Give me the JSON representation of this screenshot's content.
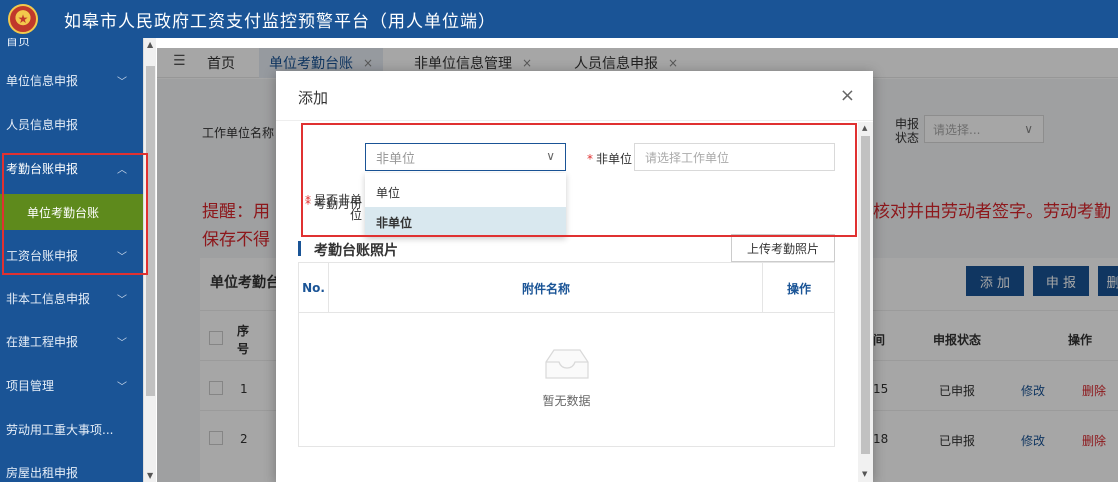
{
  "header": {
    "title": "如皋市人民政府工资支付监控预警平台（用人单位端）"
  },
  "sidebar": {
    "items": [
      {
        "label": "首页"
      },
      {
        "label": "单位信息申报"
      },
      {
        "label": "人员信息申报"
      },
      {
        "label": "考勤台账申报"
      },
      {
        "label": "单位考勤台账"
      },
      {
        "label": "工资台账申报"
      },
      {
        "label": "非本工信息申报"
      },
      {
        "label": "在建工程申报"
      },
      {
        "label": "项目管理"
      },
      {
        "label": "劳动用工重大事项..."
      },
      {
        "label": "房屋出租申报"
      }
    ]
  },
  "tabs": [
    {
      "label": "首页"
    },
    {
      "label": "单位考勤台账"
    },
    {
      "label": "非单位信息管理"
    },
    {
      "label": "人员信息申报"
    }
  ],
  "background": {
    "filter_label": "工作单位名称",
    "status_label_1": "申报",
    "status_label_2": "状态",
    "status_placeholder": "请选择...",
    "notice_left_1": "提醒：用",
    "notice_left_2": "保存不得",
    "notice_right": "核对并由劳动者签字。劳动考勤",
    "panel_title": "单位考勤台",
    "buttons": {
      "add": "添 加",
      "report": "申 报",
      "more": "删"
    },
    "table": {
      "headers": {
        "seq_1": "序",
        "seq_2": "号",
        "date": "间",
        "status": "申报状态",
        "ops": "操作"
      },
      "rows": [
        {
          "seq": "1",
          "date": "15",
          "status": "已申报",
          "edit": "修改",
          "delete": "删除"
        },
        {
          "seq": "2",
          "date": "18",
          "status": "已申报",
          "edit": "修改",
          "delete": "删除"
        }
      ]
    }
  },
  "modal": {
    "title": "添加",
    "close": "×",
    "fields": {
      "is_non_unit_label_1": "是否非单",
      "is_non_unit_label_2": "位",
      "is_non_unit_value": "非单位",
      "non_unit_label": "非单位",
      "non_unit_placeholder": "请选择工作单位",
      "month_label": "考勤月份"
    },
    "dropdown_options": [
      {
        "label": "单位"
      },
      {
        "label": "非单位"
      }
    ],
    "section_title": "考勤台账照片",
    "upload_button": "上传考勤照片",
    "attachment_table": {
      "col_no_1": "N",
      "col_no_2": "o.",
      "col_name": "附件名称",
      "col_op": "操作",
      "empty_text": "暂无数据"
    }
  }
}
